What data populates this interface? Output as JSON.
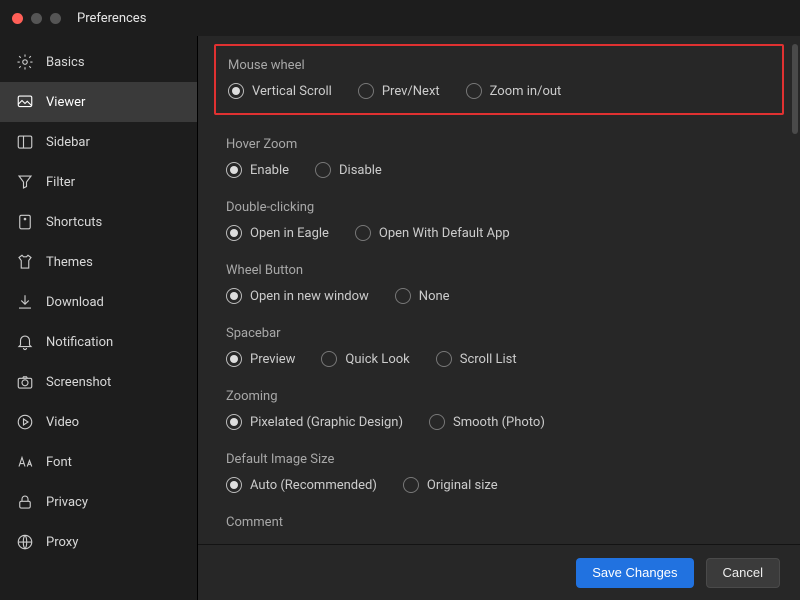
{
  "window": {
    "title": "Preferences"
  },
  "sidebar": {
    "items": [
      {
        "label": "Basics",
        "icon": "gear-icon"
      },
      {
        "label": "Viewer",
        "icon": "image-icon",
        "active": true
      },
      {
        "label": "Sidebar",
        "icon": "panel-icon"
      },
      {
        "label": "Filter",
        "icon": "funnel-icon"
      },
      {
        "label": "Shortcuts",
        "icon": "tag-icon"
      },
      {
        "label": "Themes",
        "icon": "shirt-icon"
      },
      {
        "label": "Download",
        "icon": "download-icon"
      },
      {
        "label": "Notification",
        "icon": "bell-icon"
      },
      {
        "label": "Screenshot",
        "icon": "camera-icon"
      },
      {
        "label": "Video",
        "icon": "play-icon"
      },
      {
        "label": "Font",
        "icon": "font-icon"
      },
      {
        "label": "Privacy",
        "icon": "lock-icon"
      },
      {
        "label": "Proxy",
        "icon": "globe-icon"
      }
    ]
  },
  "groups": [
    {
      "title": "Mouse wheel",
      "highlight": true,
      "options": [
        {
          "label": "Vertical Scroll",
          "selected": true
        },
        {
          "label": "Prev/Next"
        },
        {
          "label": "Zoom in/out"
        }
      ]
    },
    {
      "title": "Hover Zoom",
      "options": [
        {
          "label": "Enable",
          "selected": true
        },
        {
          "label": "Disable"
        }
      ]
    },
    {
      "title": "Double-clicking",
      "options": [
        {
          "label": "Open in Eagle",
          "selected": true
        },
        {
          "label": "Open With Default App"
        }
      ]
    },
    {
      "title": "Wheel Button",
      "options": [
        {
          "label": "Open in new window",
          "selected": true
        },
        {
          "label": "None"
        }
      ]
    },
    {
      "title": "Spacebar",
      "options": [
        {
          "label": "Preview",
          "selected": true
        },
        {
          "label": "Quick Look"
        },
        {
          "label": "Scroll List"
        }
      ]
    },
    {
      "title": "Zooming",
      "options": [
        {
          "label": "Pixelated (Graphic Design)",
          "selected": true
        },
        {
          "label": "Smooth (Photo)"
        }
      ]
    },
    {
      "title": "Default Image Size",
      "options": [
        {
          "label": "Auto (Recommended)",
          "selected": true
        },
        {
          "label": "Original size"
        }
      ]
    },
    {
      "title": "Comment",
      "options": []
    }
  ],
  "footer": {
    "save_label": "Save Changes",
    "cancel_label": "Cancel"
  }
}
